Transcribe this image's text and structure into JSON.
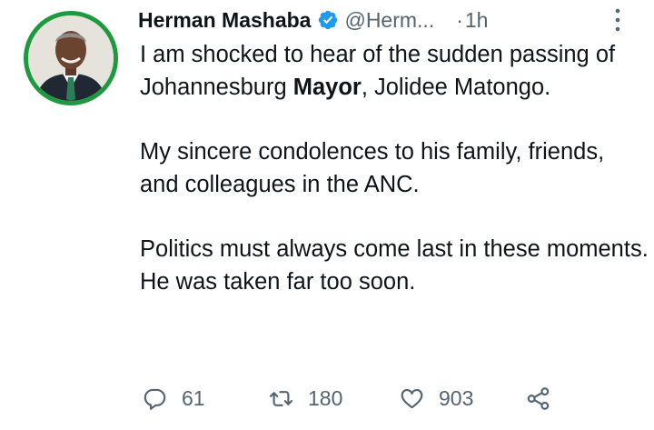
{
  "author": {
    "name": "Herman Mashaba",
    "handle": "@Herm...",
    "time": "1h",
    "separator": "·",
    "verified": true,
    "avatar_ring_color": "#1c9a3d"
  },
  "tweet": {
    "paragraph_1_before": "I am shocked to hear of the sudden passing of Johannesburg ",
    "paragraph_1_bold": "Mayor",
    "paragraph_1_after": ", Jolidee Matongo.",
    "paragraph_2": "My sincere condolences to his family, friends, and colleagues in the ANC.",
    "paragraph_3": "Politics must always come last in these moments. He was taken far too soon."
  },
  "actions": {
    "reply": {
      "icon": "reply-icon",
      "count": "61"
    },
    "retweet": {
      "icon": "retweet-icon",
      "count": "180"
    },
    "like": {
      "icon": "heart-icon",
      "count": "903"
    },
    "share": {
      "icon": "share-icon"
    }
  },
  "colors": {
    "verified_badge": "#1d9bf0",
    "secondary_text": "#536471",
    "primary_text": "#0f1419"
  }
}
